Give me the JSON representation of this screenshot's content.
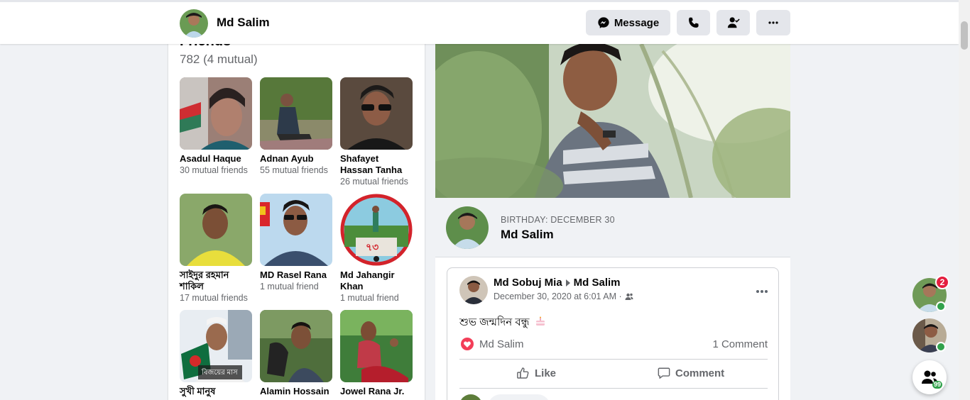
{
  "header": {
    "name": "Md Salim",
    "message_label": "Message",
    "call_icon": "phone-icon",
    "friend_icon": "friend-check-icon",
    "more_icon": "more-icon"
  },
  "friends": {
    "title": "Friends",
    "count": "782 (4 mutual)",
    "items": [
      {
        "name": "Asadul Haque",
        "mutual": "30 mutual friends"
      },
      {
        "name": "Adnan Ayub",
        "mutual": "55 mutual friends"
      },
      {
        "name": "Shafayet Hassan Tanha",
        "mutual": "26 mutual friends"
      },
      {
        "name": "সাইদুর রহমান শাকিল",
        "mutual": "17 mutual friends"
      },
      {
        "name": "MD Rasel Rana",
        "mutual": "1 mutual friend"
      },
      {
        "name": "Md Jahangir Khan",
        "mutual": "1 mutual friend"
      },
      {
        "name": "সুখী মানুষ",
        "mutual": ""
      },
      {
        "name": "Alamin Hossain",
        "mutual": ""
      },
      {
        "name": "Jowel Rana Jr.",
        "mutual": ""
      }
    ]
  },
  "birthday": {
    "label": "BIRTHDAY: DECEMBER 30",
    "name": "Md Salim"
  },
  "post": {
    "author": "Md Sobuj Mia",
    "target": "Md Salim",
    "time": "December 30, 2020 at 6:01 AM ·",
    "text": "শুভ জন্মদিন বন্ধু",
    "reactor": "Md Salim",
    "comment_count": "1 Comment",
    "like_label": "Like",
    "comment_label": "Comment"
  },
  "chat": {
    "badge": "2",
    "contacts_count": "99"
  },
  "colors": {
    "accent": "#1877f2",
    "online": "#31a24c",
    "badge": "#e41e3f",
    "heart": "#f33e58"
  }
}
